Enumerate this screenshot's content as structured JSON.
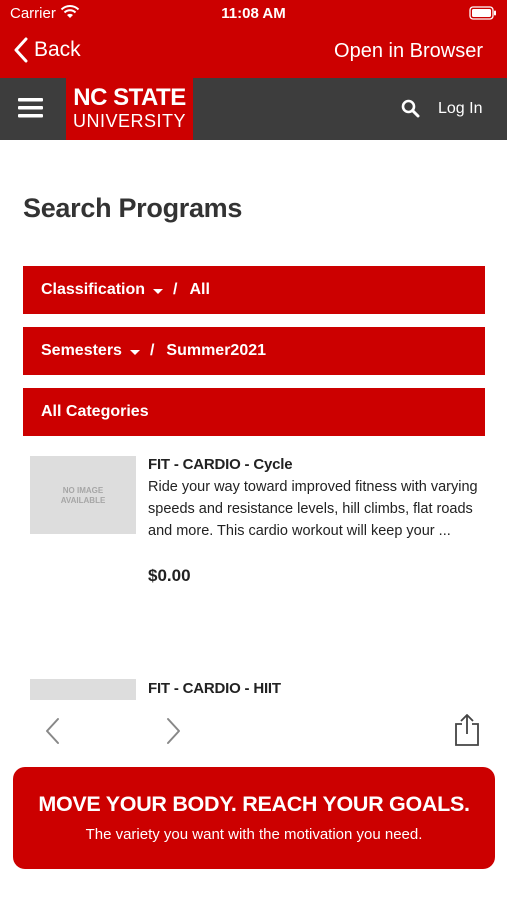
{
  "status_bar": {
    "carrier": "Carrier",
    "time": "11:08 AM"
  },
  "nav_bar": {
    "back_label": "Back",
    "open_in_browser_label": "Open in Browser"
  },
  "site_header": {
    "logo_top": "NC STATE",
    "logo_bottom": "UNIVERSITY",
    "login_label": "Log In",
    "icons": [
      "hamburger-menu-icon",
      "search-icon"
    ]
  },
  "page": {
    "title": "Search Programs"
  },
  "filters": {
    "classification": {
      "label": "Classification",
      "separator": "/",
      "value": "All"
    },
    "semesters": {
      "label": "Semesters",
      "separator": "/",
      "value": "Summer2021"
    },
    "categories": {
      "label": "All Categories"
    }
  },
  "programs": [
    {
      "image_placeholder": "NO IMAGE AVAILABLE",
      "title": "FIT - CARDIO - Cycle",
      "description": "Ride your way toward improved fitness with varying speeds and resistance levels, hill climbs, flat roads and more. This cardio workout will keep your ...",
      "price": "$0.00"
    },
    {
      "title": "FIT - CARDIO - HIIT"
    }
  ],
  "toolbar": {
    "icons": [
      "chevron-left-icon",
      "chevron-right-icon",
      "share-icon"
    ]
  },
  "banner": {
    "headline": "MOVE YOUR BODY. REACH YOUR GOALS.",
    "subtext": "The variety you want with the motivation you need."
  },
  "colors": {
    "brand_red": "#cc0000",
    "header_gray": "#3d3d3d"
  }
}
